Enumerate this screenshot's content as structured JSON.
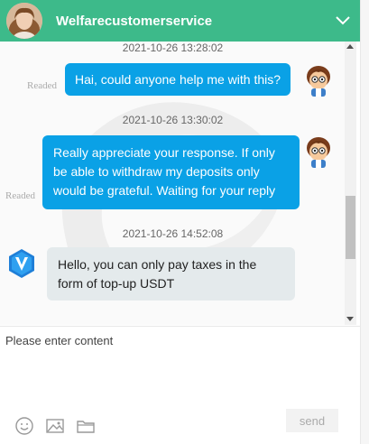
{
  "header": {
    "title": "Welfarecustomerservice",
    "avatar_icon": "female-agent-avatar",
    "collapse_icon": "chevron-down-icon",
    "color": "#3dba8a"
  },
  "chat": {
    "messages": [
      {
        "direction": "out",
        "timestamp": "2021-10-26 13:28:02",
        "status": "Readed",
        "text": "Hai, could anyone help me with this?",
        "avatar": "cartoon-boy-avatar"
      },
      {
        "direction": "out",
        "timestamp": "2021-10-26 13:30:02",
        "status": "Readed",
        "lines": [
          "Really appreciate your response. If only",
          "be able to withdraw my deposits only",
          "would be grateful. Waiting for your reply"
        ],
        "avatar": "cartoon-boy-avatar"
      },
      {
        "direction": "in",
        "timestamp": "2021-10-26 14:52:08",
        "lines": [
          "Hello, you can only pay taxes in the",
          "form of top-up USDT"
        ],
        "avatar": "v-logo-avatar"
      }
    ],
    "outgoing_color": "#0aa1e6",
    "incoming_color": "#e4eaec"
  },
  "composer": {
    "placeholder": "Please enter content",
    "send_label": "send",
    "tools": [
      "emoji-icon",
      "image-icon",
      "folder-icon"
    ]
  }
}
